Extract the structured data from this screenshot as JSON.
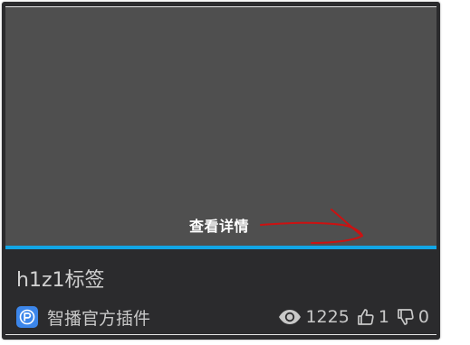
{
  "card": {
    "view_details_label": "查看详情",
    "title": "h1z1标签",
    "author": {
      "name": "智播官方插件",
      "logo_icon": "plugin-logo-icon"
    },
    "stats": {
      "views": "1225",
      "likes": "1",
      "dislikes": "0"
    }
  },
  "colors": {
    "card_background": "#2b2b2d",
    "preview_background": "#4f4f4f",
    "accent_bar": "#12a6e6",
    "annotation_arrow": "#cc1111",
    "logo_background": "#3c86ea"
  }
}
